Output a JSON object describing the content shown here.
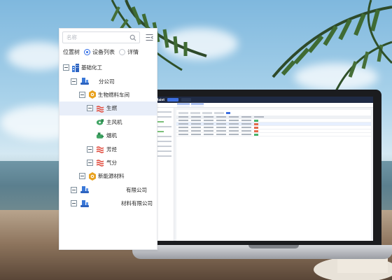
{
  "tree_panel": {
    "search": {
      "placeholder": "名称",
      "value": ""
    },
    "view": {
      "label": "位置树",
      "options": [
        {
          "label": "设备列表",
          "selected": true
        },
        {
          "label": "详情",
          "selected": false
        }
      ]
    },
    "nodes": [
      {
        "label": "基础化工",
        "icon": "org-building-icon",
        "level": 0,
        "expanded": true
      },
      {
        "label": "分公司",
        "icon": "branch-company-icon",
        "level": 1,
        "expanded": true
      },
      {
        "label": "生物燃料车间",
        "icon": "workshop-icon",
        "level": 2,
        "expanded": true
      },
      {
        "label": "生燃",
        "icon": "process-section-icon",
        "level": 3,
        "expanded": true,
        "selected": true
      },
      {
        "label": "主风机",
        "icon": "fan-equipment-icon",
        "level": 4
      },
      {
        "label": "烟机",
        "icon": "turbine-equipment-icon",
        "level": 4
      },
      {
        "label": "芳烃",
        "icon": "process-section-icon",
        "level": 3,
        "expanded": true
      },
      {
        "label": "气分",
        "icon": "process-section-icon",
        "level": 3,
        "expanded": true
      },
      {
        "label": "新能源材料",
        "icon": "workshop-icon",
        "level": 2,
        "expanded": true
      },
      {
        "label": "有限公司",
        "icon": "branch-company-icon",
        "level": 1,
        "expanded": true
      },
      {
        "label": "材料有限公司",
        "icon": "branch-company-icon",
        "level": 1,
        "expanded": true
      }
    ]
  },
  "colors": {
    "accent": "#2e6be6",
    "selected_row": "#e8eef9",
    "building_blue": "#3a78d8",
    "workshop_gold": "#e9a21f",
    "section_red": "#e3574a",
    "equipment_green": "#3fa463"
  }
}
